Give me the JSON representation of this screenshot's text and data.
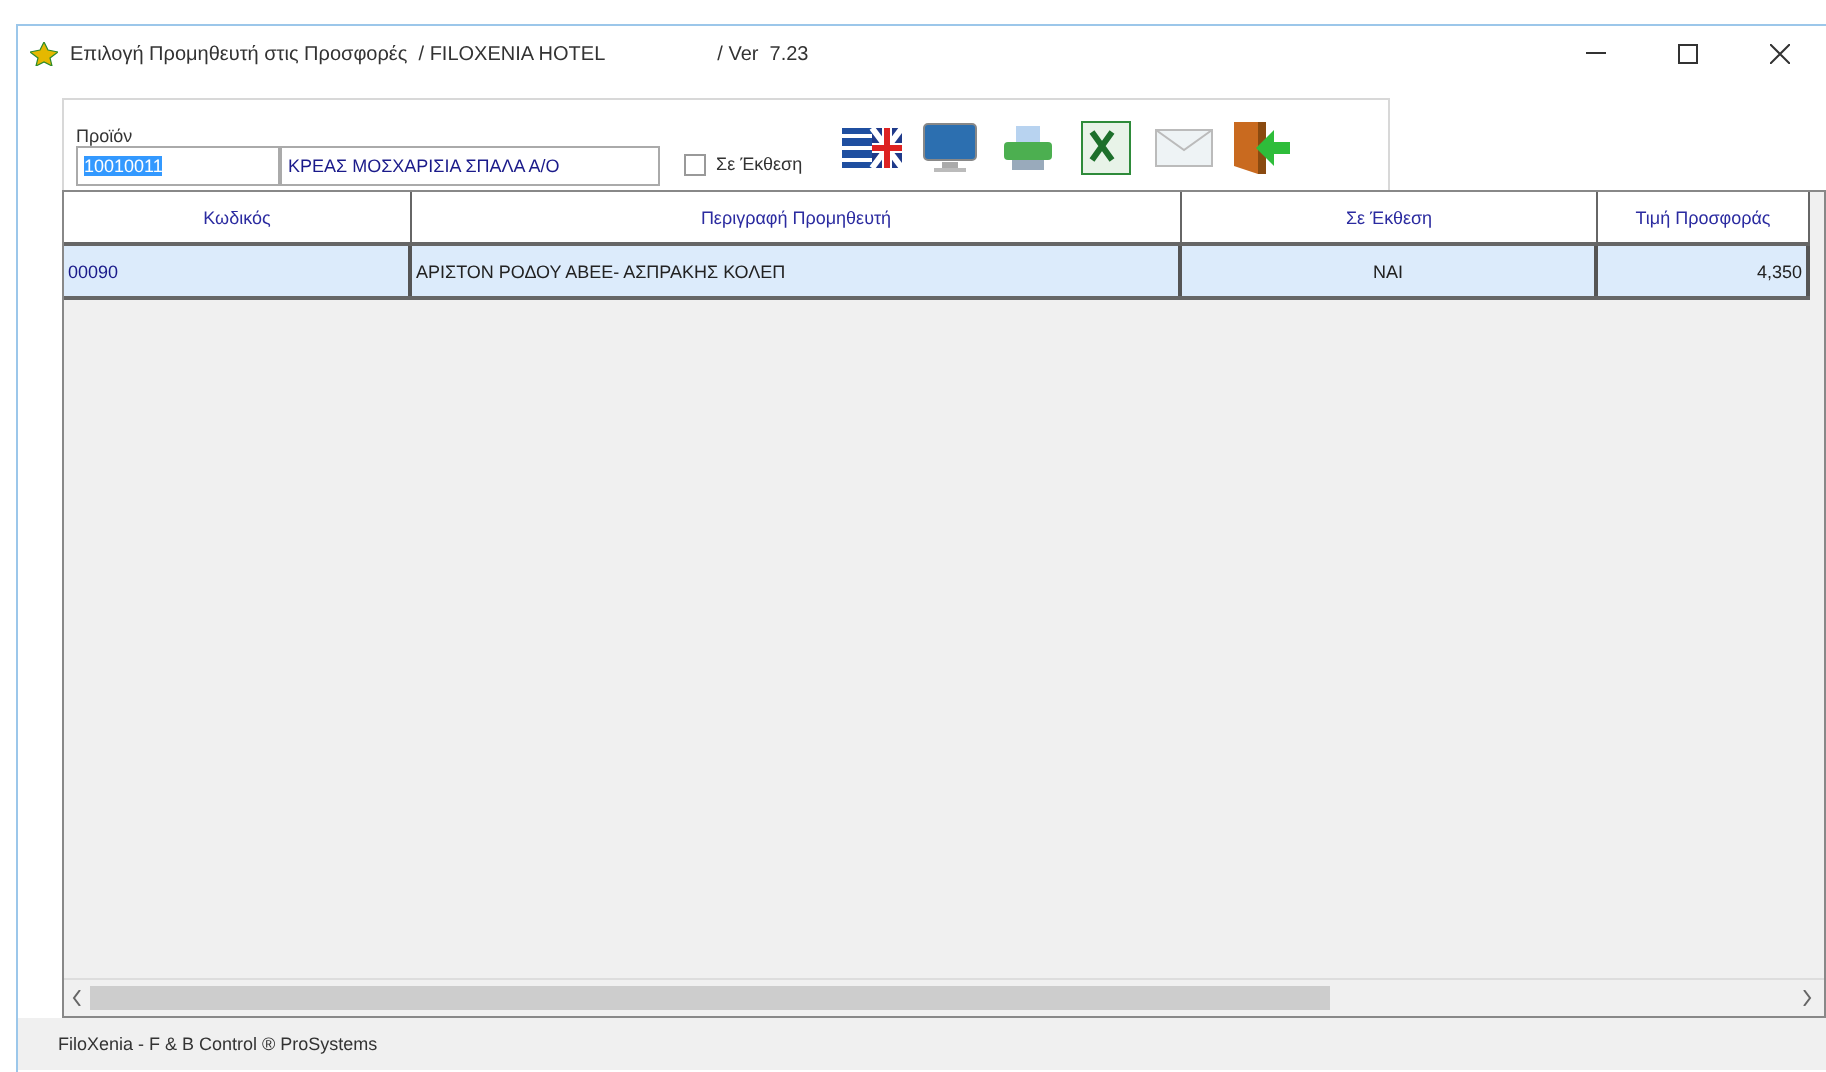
{
  "window": {
    "title": "Επιλογή Προμηθευτή στις Προσφορές  / FILOXENIA HOTEL",
    "version": "/ Ver  7.23"
  },
  "product": {
    "label": "Προϊόν",
    "code": "10010011",
    "description": "ΚΡΕΑΣ ΜΟΣΧΑΡΙΣΙΑ ΣΠΑΛΑ Α/Ο"
  },
  "filter": {
    "label": "Σε Έκθεση",
    "checked": false
  },
  "toolbar": [
    {
      "kind": "language"
    },
    {
      "kind": "screen"
    },
    {
      "kind": "print"
    },
    {
      "kind": "excel"
    },
    {
      "kind": "email"
    },
    {
      "kind": "exit"
    }
  ],
  "table": {
    "columns": [
      "Κωδικός",
      "Περιγραφή Προμηθευτή",
      "Σε Έκθεση",
      "Τιμή Προσφοράς"
    ],
    "rows": [
      {
        "cells": [
          "00090",
          "ΑΡΙΣΤΟΝ ΡΟΔΟΥ ΑΒΕΕ- ΑΣΠΡΑΚΗΣ ΚΟΛΕΠ",
          "ΝΑΙ",
          "4,350"
        ],
        "selected": true
      }
    ]
  },
  "status_bar": "FiloXenia - F & B Control  ® ProSystems"
}
